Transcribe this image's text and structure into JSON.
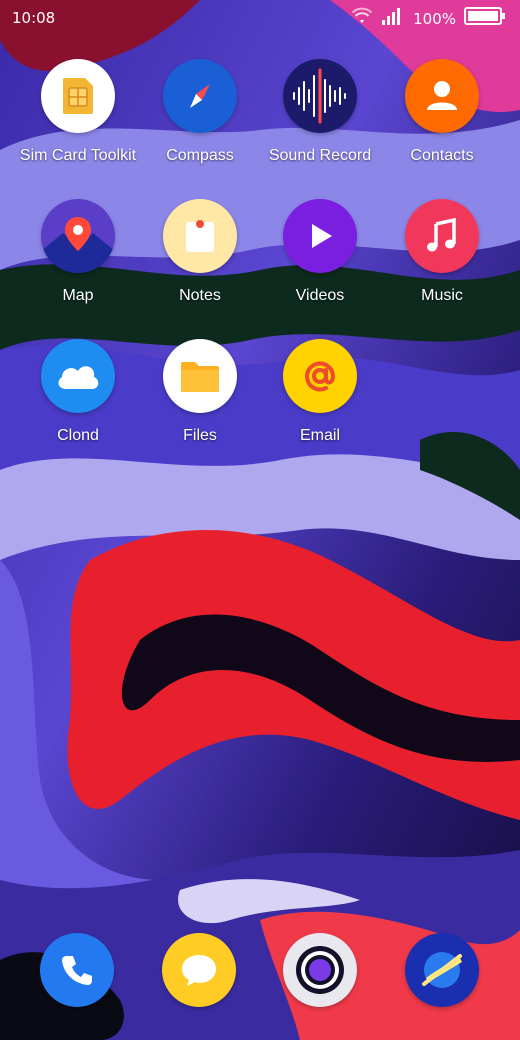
{
  "status_bar": {
    "time": "10:08",
    "battery": "100%",
    "icons": [
      "wifi-icon",
      "signal-icon",
      "battery-icon"
    ]
  },
  "apps": [
    {
      "label": "Sim Card Toolkit",
      "icon": "sim-card-icon",
      "color": "#ffffff"
    },
    {
      "label": "Compass",
      "icon": "compass-icon",
      "color": "#1a5fd6"
    },
    {
      "label": "Sound Record",
      "icon": "sound-wave-icon",
      "color": "#1c1b6b"
    },
    {
      "label": "Contacts",
      "icon": "person-icon",
      "color": "#ff6a00"
    },
    {
      "label": "Map",
      "icon": "map-pin-icon",
      "color": "#2a2a8a"
    },
    {
      "label": "Notes",
      "icon": "note-icon",
      "color": "#ffe8a6"
    },
    {
      "label": "Videos",
      "icon": "play-icon",
      "color": "#7a1fe0"
    },
    {
      "label": "Music",
      "icon": "music-note-icon",
      "color": "#f2385a"
    },
    {
      "label": "Clond",
      "icon": "cloud-icon",
      "color": "#1e8cf0"
    },
    {
      "label": "Files",
      "icon": "folder-icon",
      "color": "#ffffff"
    },
    {
      "label": "Email",
      "icon": "at-icon",
      "color": "#ffd200"
    }
  ],
  "dock": [
    {
      "name": "phone",
      "icon": "phone-icon",
      "color": "#2379f0"
    },
    {
      "name": "messages",
      "icon": "chat-bubble-icon",
      "color": "#ffcc26"
    },
    {
      "name": "camera",
      "icon": "camera-lens-icon",
      "color": "#e8e8ee"
    },
    {
      "name": "browser",
      "icon": "planet-icon",
      "color": "#1a2fb0"
    }
  ]
}
